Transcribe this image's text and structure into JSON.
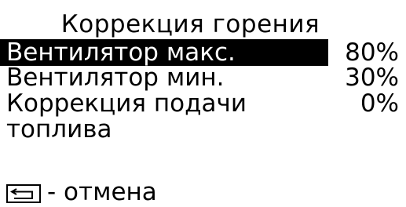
{
  "screen": {
    "title": "Коррекция горения",
    "items": [
      {
        "label": "Вентилятор макс.",
        "value": "80%",
        "selected": true
      },
      {
        "label": "Вентилятор мин.",
        "value": "30%",
        "selected": false
      },
      {
        "label": "Коррекция подачи",
        "label_cont": "топлива",
        "value": "0%",
        "selected": false
      }
    ],
    "footer": {
      "icon": "back-icon",
      "text": "- отмена"
    }
  }
}
